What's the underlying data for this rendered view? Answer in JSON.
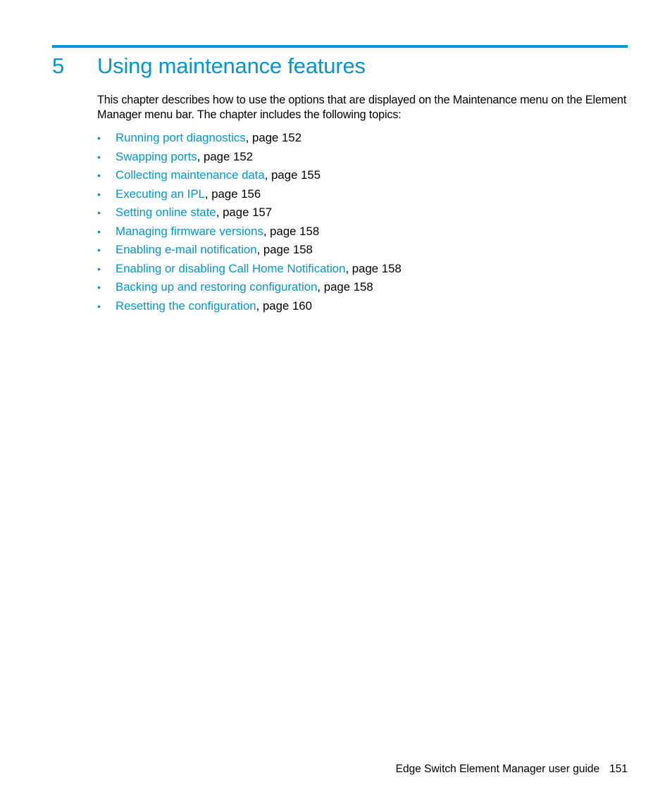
{
  "chapter": {
    "number": "5",
    "title": "Using maintenance features",
    "accent_color": "#0096d6"
  },
  "intro": "This chapter describes how to use the options that are displayed on the Maintenance menu on the Element Manager menu bar. The chapter includes the following topics:",
  "topics": [
    {
      "link": "Running port diagnostics",
      "suffix": ", page 152"
    },
    {
      "link": "Swapping ports",
      "suffix": ", page 152"
    },
    {
      "link": "Collecting maintenance data",
      "suffix": ", page 155"
    },
    {
      "link": "Executing an IPL",
      "suffix": ", page 156"
    },
    {
      "link": "Setting online state",
      "suffix": ", page 157"
    },
    {
      "link": "Managing firmware versions",
      "suffix": ", page 158"
    },
    {
      "link": "Enabling e-mail notification",
      "suffix": ", page 158"
    },
    {
      "link": "Enabling or disabling Call Home Notification",
      "suffix": ", page 158"
    },
    {
      "link": "Backing up and restoring configuration",
      "suffix": ", page 158"
    },
    {
      "link": "Resetting the configuration",
      "suffix": ", page 160"
    }
  ],
  "bullet_glyph": "•",
  "footer": {
    "guide_title": "Edge Switch Element Manager user guide",
    "page_number": "151"
  }
}
